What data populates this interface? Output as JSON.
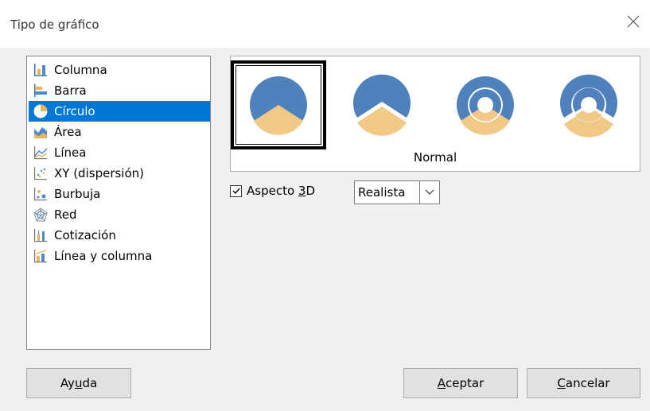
{
  "dialog": {
    "title": "Tipo de gráfico"
  },
  "chart_types": [
    {
      "label": "Columna",
      "icon": "column-chart-icon"
    },
    {
      "label": "Barra",
      "icon": "bar-chart-icon"
    },
    {
      "label": "Círculo",
      "icon": "pie-chart-icon",
      "selected": true
    },
    {
      "label": "Área",
      "icon": "area-chart-icon"
    },
    {
      "label": "Línea",
      "icon": "line-chart-icon"
    },
    {
      "label": "XY (dispersión)",
      "icon": "scatter-chart-icon"
    },
    {
      "label": "Burbuja",
      "icon": "bubble-chart-icon"
    },
    {
      "label": "Red",
      "icon": "net-chart-icon"
    },
    {
      "label": "Cotización",
      "icon": "stock-chart-icon"
    },
    {
      "label": "Línea y columna",
      "icon": "column-line-chart-icon"
    }
  ],
  "variants": {
    "caption": "Normal",
    "items": [
      "pie-normal",
      "pie-exploded",
      "donut",
      "donut-exploded"
    ],
    "selected_index": 0
  },
  "aspect3d": {
    "label_pre": "Aspecto ",
    "label_mnemonic": "3",
    "label_post": "D",
    "checked": true
  },
  "style_select": {
    "value": "Realista"
  },
  "buttons": {
    "help": {
      "pre": "Ay",
      "mnemonic": "u",
      "post": "da"
    },
    "ok": {
      "pre": "",
      "mnemonic": "A",
      "post": "ceptar"
    },
    "cancel": {
      "pre": "",
      "mnemonic": "C",
      "post": "ancelar"
    }
  },
  "colors": {
    "selection": "#0078d7",
    "pie_blue": "#4f81bd",
    "pie_tan": "#f0c987"
  }
}
